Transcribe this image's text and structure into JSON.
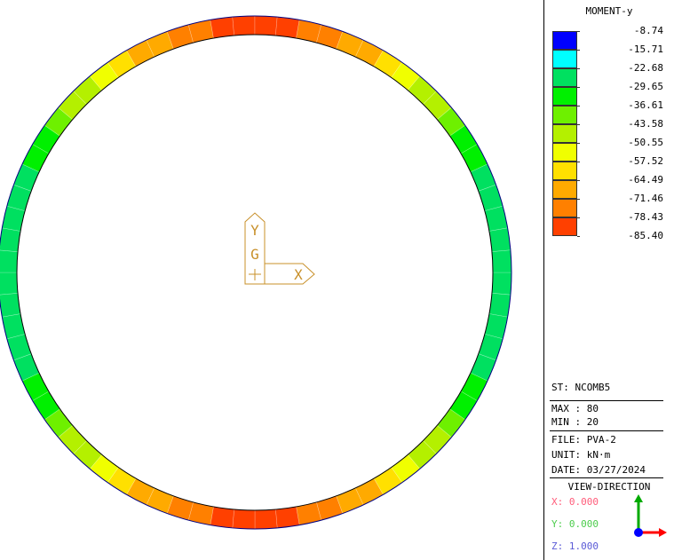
{
  "legend": {
    "title": "MOMENT-y",
    "values": [
      "-8.74",
      "-15.71",
      "-22.68",
      "-29.65",
      "-36.61",
      "-43.58",
      "-50.55",
      "-57.52",
      "-64.49",
      "-71.46",
      "-78.43",
      "-85.40"
    ],
    "colors": [
      "#0000ff",
      "#00ffff",
      "#00e060",
      "#00f000",
      "#6ef000",
      "#b4f000",
      "#f0ff00",
      "#ffe000",
      "#ffaa00",
      "#ff8000",
      "#ff4000"
    ]
  },
  "info": {
    "st": "ST: NCOMB5",
    "max": "MAX : 80",
    "min": "MIN : 20",
    "file": "FILE: PVA-2",
    "unit": "UNIT: kN·m",
    "date": "DATE: 03/27/2024"
  },
  "view": {
    "title": "VIEW-DIRECTION",
    "x": "X: 0.000",
    "y": "Y: 0.000",
    "z": "Z: 1.000"
  },
  "origin_axes": {
    "y": "Y",
    "g": "G",
    "x": "X"
  },
  "colors": {
    "axis_marker": "#c8902a",
    "ring_outline": "#000080",
    "x_axis": "#ff0000",
    "y_axis": "#00aa00",
    "z_axis": "#0000ff"
  }
}
